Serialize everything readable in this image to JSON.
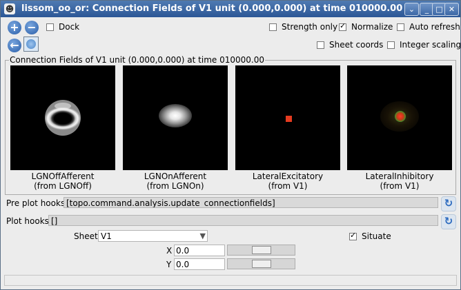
{
  "window": {
    "title": "lissom_oo_or: Connection Fields of V1 unit (0.000,0.000) at time 010000.00",
    "controls": {
      "menu": "⌄",
      "minimize": "_",
      "maximize": "□",
      "close": "✕"
    }
  },
  "toolbar": {
    "zoom_in": "+",
    "zoom_out": "−",
    "back": "←",
    "dock_label": "Dock",
    "strength_only_label": "Strength only",
    "normalize_label": "Normalize",
    "auto_refresh_label": "Auto refresh",
    "sheet_coords_label": "Sheet coords",
    "integer_scaling_label": "Integer scaling",
    "checks": {
      "dock": false,
      "strength_only": false,
      "normalize": true,
      "auto_refresh": false,
      "sheet_coords": false,
      "integer_scaling": false
    }
  },
  "plots": {
    "frame_title": "Connection Fields of V1 unit (0.000,0.000) at time 010000.00",
    "items": [
      {
        "name": "LGNOffAfferent",
        "source": "(from LGNOff)"
      },
      {
        "name": "LGNOnAfferent",
        "source": "(from LGNOn)"
      },
      {
        "name": "LateralExcitatory",
        "source": "(from V1)"
      },
      {
        "name": "LateralInhibitory",
        "source": "(from V1)"
      }
    ]
  },
  "hooks": {
    "pre_plot_label": "Pre plot hooks",
    "pre_plot_value": "[topo.command.analysis.update_connectionfields]",
    "plot_label": "Plot hooks",
    "plot_value": "[]",
    "refresh_icon": "↻"
  },
  "params": {
    "sheet_label": "Sheet",
    "sheet_value": "V1",
    "situate_label": "Situate",
    "situate_checked": true,
    "x_label": "X",
    "x_value": "0.0",
    "x_slider_fraction": 0.5,
    "y_label": "Y",
    "y_value": "0.0",
    "y_slider_fraction": 0.5
  }
}
